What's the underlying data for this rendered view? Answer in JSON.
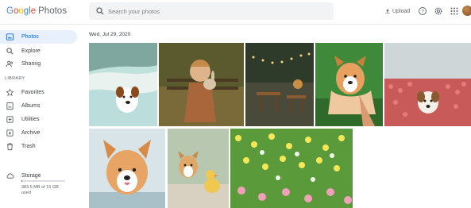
{
  "app": {
    "logo_letters": [
      "G",
      "o",
      "o",
      "g",
      "l",
      "e"
    ],
    "product": "Photos"
  },
  "search": {
    "placeholder": "Search your photos"
  },
  "header": {
    "upload_label": "Upload"
  },
  "sidebar": {
    "items": [
      {
        "label": "Photos",
        "icon": "photo-icon",
        "active": true
      },
      {
        "label": "Explore",
        "icon": "search-icon"
      },
      {
        "label": "Sharing",
        "icon": "people-icon"
      }
    ],
    "library_label": "LIBRARY",
    "library_items": [
      {
        "label": "Favorites",
        "icon": "star-icon"
      },
      {
        "label": "Albums",
        "icon": "album-icon"
      },
      {
        "label": "Utilities",
        "icon": "utilities-icon"
      },
      {
        "label": "Archive",
        "icon": "archive-icon"
      },
      {
        "label": "Trash",
        "icon": "trash-icon"
      }
    ],
    "storage": {
      "label": "Storage",
      "usage_text": "383.5 MB of 15 GB used",
      "fraction_used": 0.025
    }
  },
  "main": {
    "date_header": "Wed, Jul 29, 2020",
    "photos": [
      {
        "name": "photo-dog-beach"
      },
      {
        "name": "photo-child-rabbit"
      },
      {
        "name": "photo-patio-lights"
      },
      {
        "name": "photo-corgi-held"
      },
      {
        "name": "photo-dog-tulips"
      },
      {
        "name": "photo-corgi-closeup"
      },
      {
        "name": "photo-puppy-duckling"
      },
      {
        "name": "photo-flower-field"
      }
    ]
  },
  "colors": {
    "accent": "#1a73e8",
    "active_nav_bg": "#e8f0fe",
    "search_bg": "#f1f3f4"
  }
}
